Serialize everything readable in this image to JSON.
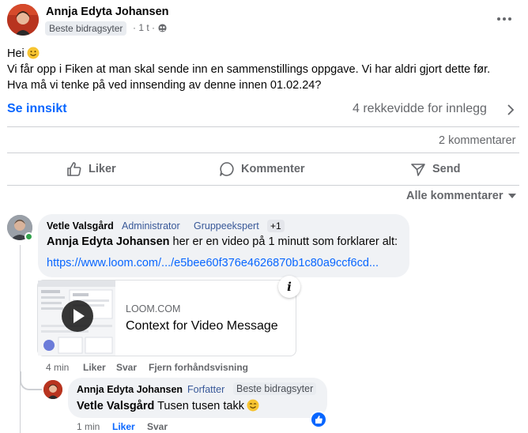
{
  "post": {
    "author": "Annja Edyta Johansen",
    "badge": "Beste bidragsyter",
    "time": "· 1 t ·",
    "greeting": "Hei",
    "line1": "Vi får opp i Fiken at man skal sende inn en sammenstillings oppgave. Vi har aldri gjort dette før.",
    "line2": "Hva må vi tenke på ved innsending av denne innen 01.02.24?",
    "insight_label": "Se innsikt",
    "reach": "4 rekkevidde for innlegg",
    "comment_count": "2 kommentarer"
  },
  "actions": {
    "like": "Liker",
    "comment": "Kommenter",
    "send": "Send"
  },
  "sort": {
    "label": "Alle kommentarer"
  },
  "comment1": {
    "author": "Vetle Valsgård",
    "role1": "Administrator",
    "role2": "Gruppeekspert",
    "extra": "+1",
    "mention": "Annja Edyta Johansen",
    "text": " her er en video på 1 minutt som forklarer alt:",
    "link": "https://www.loom.com/.../e5bee60f376e4626870b1c80a9ccf6cd...",
    "preview": {
      "domain": "LOOM.COM",
      "title": "Context for Video Message",
      "info": "i"
    },
    "time": "4 min",
    "like": "Liker",
    "reply": "Svar",
    "remove_preview": "Fjern forhåndsvisning"
  },
  "comment2": {
    "author": "Annja Edyta Johansen",
    "role": "Forfatter",
    "badge": "Beste bidragsyter",
    "mention": "Vetle Valsgård",
    "text": " Tusen tusen takk",
    "time": "1 min",
    "like": "Liker",
    "reply": "Svar"
  },
  "colors": {
    "accent": "#0866ff",
    "secondary_text": "#65676b",
    "bubble": "#f0f2f5",
    "online": "#31a24c"
  }
}
